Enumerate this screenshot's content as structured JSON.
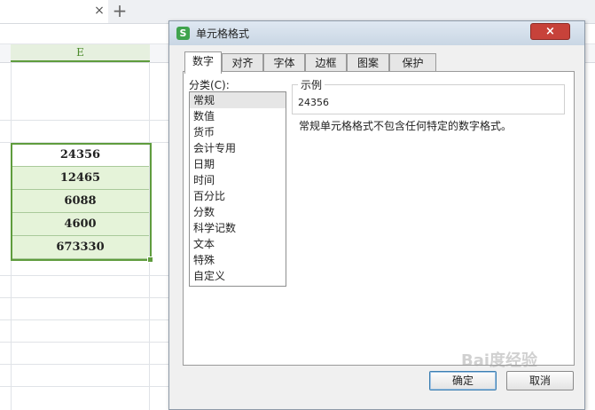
{
  "spreadsheet": {
    "column_header": "E",
    "cells": [
      "24356",
      "12465",
      "6088",
      "4600",
      "673330"
    ]
  },
  "tabbar": {
    "close_glyph": "×",
    "add_glyph": "+"
  },
  "dialog": {
    "title": "单元格格式",
    "app_icon_letter": "S",
    "close_glyph": "×",
    "tabs": [
      "数字",
      "对齐",
      "字体",
      "边框",
      "图案",
      "保护"
    ],
    "active_tab": 0,
    "category_label": "分类(C):",
    "categories": [
      "常规",
      "数值",
      "货币",
      "会计专用",
      "日期",
      "时间",
      "百分比",
      "分数",
      "科学记数",
      "文本",
      "特殊",
      "自定义"
    ],
    "selected_category": 0,
    "sample_legend": "示例",
    "sample_value": "24356",
    "description": "常规单元格格式不包含任何特定的数字格式。",
    "ok_label": "确定",
    "cancel_label": "取消"
  },
  "watermark": "Bai度经验",
  "colors": {
    "selection_green": "#5f9c3d",
    "selected_cell_fill": "#e5f3d9",
    "close_button_red": "#c7423a"
  }
}
